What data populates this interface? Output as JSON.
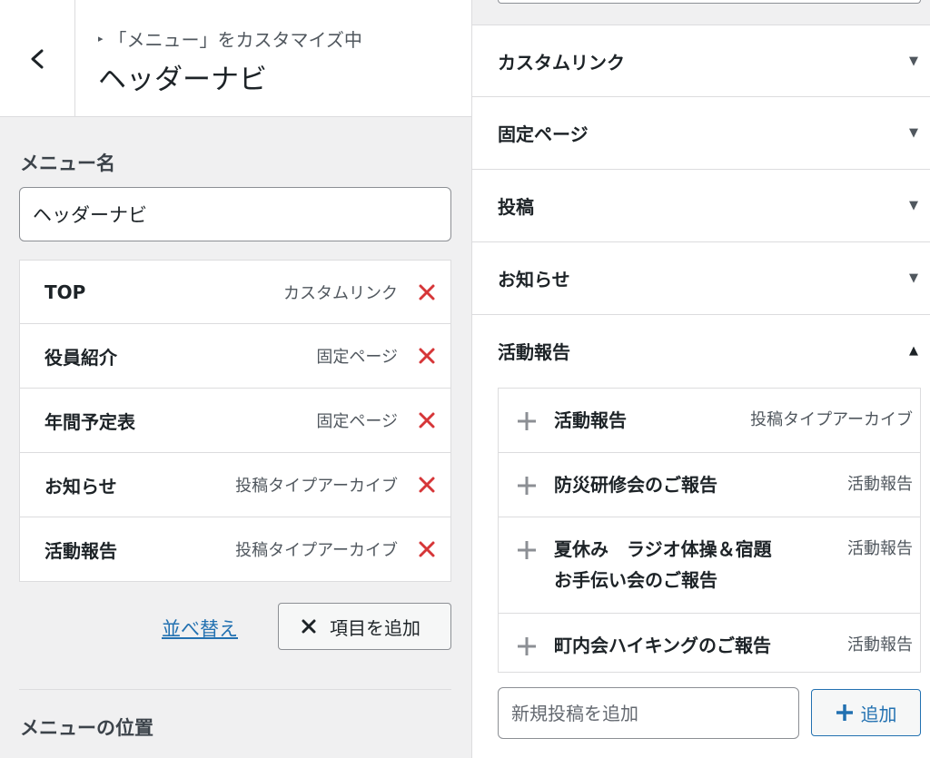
{
  "header": {
    "breadcrumb": "「メニュー」をカスタマイズ中",
    "title": "ヘッダーナビ"
  },
  "menu_name": {
    "label": "メニュー名",
    "value": "ヘッダーナビ"
  },
  "menu_items": [
    {
      "title": "TOP",
      "type": "カスタムリンク"
    },
    {
      "title": "役員紹介",
      "type": "固定ページ"
    },
    {
      "title": "年間予定表",
      "type": "固定ページ"
    },
    {
      "title": "お知らせ",
      "type": "投稿タイプアーカイブ"
    },
    {
      "title": "活動報告",
      "type": "投稿タイプアーカイブ"
    }
  ],
  "actions": {
    "reorder": "並べ替え",
    "add_item": "項目を追加"
  },
  "menu_position_label": "メニューの位置",
  "sections": {
    "custom_link": "カスタムリンク",
    "pages": "固定ページ",
    "posts": "投稿",
    "news": "お知らせ",
    "activity": "活動報告"
  },
  "available_items": [
    {
      "title": "活動報告",
      "type": "投稿タイプアーカイブ"
    },
    {
      "title": "防災研修会のご報告",
      "type": "活動報告"
    },
    {
      "title_line1": "夏休み　ラジオ体操＆宿題",
      "title_line2": "お手伝い会のご報告",
      "type": "活動報告"
    },
    {
      "title": "町内会ハイキングのご報告",
      "type": "活動報告"
    }
  ],
  "new_post": {
    "placeholder": "新規投稿を追加",
    "add_label": "追加"
  },
  "colors": {
    "accent": "#2271b1",
    "delete": "#d63638"
  }
}
